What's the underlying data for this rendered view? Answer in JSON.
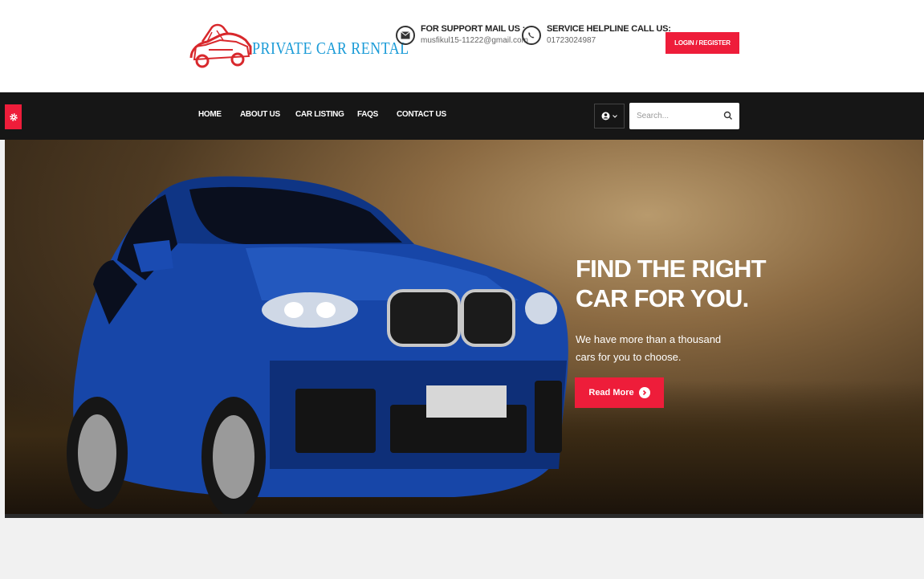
{
  "brand": {
    "name": "PRIVATE CAR RENTAL"
  },
  "header": {
    "support": {
      "label": "FOR SUPPORT MAIL US :",
      "value": "musfikul15-11222@gmail.com"
    },
    "helpline": {
      "label": "SERVICE HELPLINE CALL US:",
      "value": "01723024987"
    },
    "login_label": "LOGIN / REGISTER"
  },
  "nav": {
    "items": [
      "HOME",
      "ABOUT US",
      "CAR LISTING",
      "FAQS",
      "CONTACT US"
    ],
    "search_placeholder": "Search..."
  },
  "hero": {
    "title_line1": "FIND THE RIGHT",
    "title_line2": "CAR FOR YOU.",
    "subtitle": "We have more than a thousand cars for you to choose.",
    "button_label": "Read More"
  },
  "colors": {
    "accent": "#ee1d3a",
    "navbar": "#161616",
    "logo_text": "#1a9bd7",
    "car_blue": "#1746a8"
  },
  "icons": [
    "car-logo-icon",
    "envelope-icon",
    "phone-icon",
    "user-icon",
    "chevron-down-icon",
    "search-icon",
    "gear-icon",
    "arrow-right-icon"
  ]
}
